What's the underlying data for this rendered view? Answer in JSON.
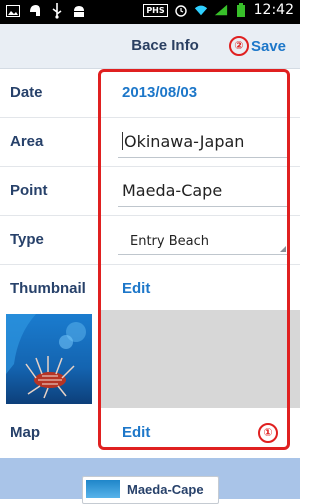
{
  "status_bar": {
    "time": "12:42",
    "phs_label": "PHS",
    "icons": [
      "image-icon",
      "helmet-icon",
      "usb-icon",
      "android-icon",
      "alarm-icon",
      "wifi-icon",
      "signal-icon",
      "battery-icon"
    ]
  },
  "header": {
    "title": "Bace Info",
    "save_label": "Save",
    "save_marker": "②"
  },
  "fields": {
    "date": {
      "label": "Date",
      "value": "2013/08/03"
    },
    "area": {
      "label": "Area",
      "value": "Okinawa-Japan"
    },
    "point": {
      "label": "Point",
      "value": "Maeda-Cape"
    },
    "type": {
      "label": "Type",
      "value": "Entry Beach"
    },
    "thumbnail": {
      "label": "Thumbnail",
      "edit_label": "Edit"
    },
    "map": {
      "label": "Map",
      "edit_label": "Edit"
    }
  },
  "annotations": {
    "marker_1": "①"
  },
  "map_preview": {
    "label": "Maeda-Cape"
  },
  "colors": {
    "accent": "#1d77c9",
    "label": "#27416a",
    "highlight": "#e02020",
    "bottom_bg": "#a9c4e8"
  }
}
